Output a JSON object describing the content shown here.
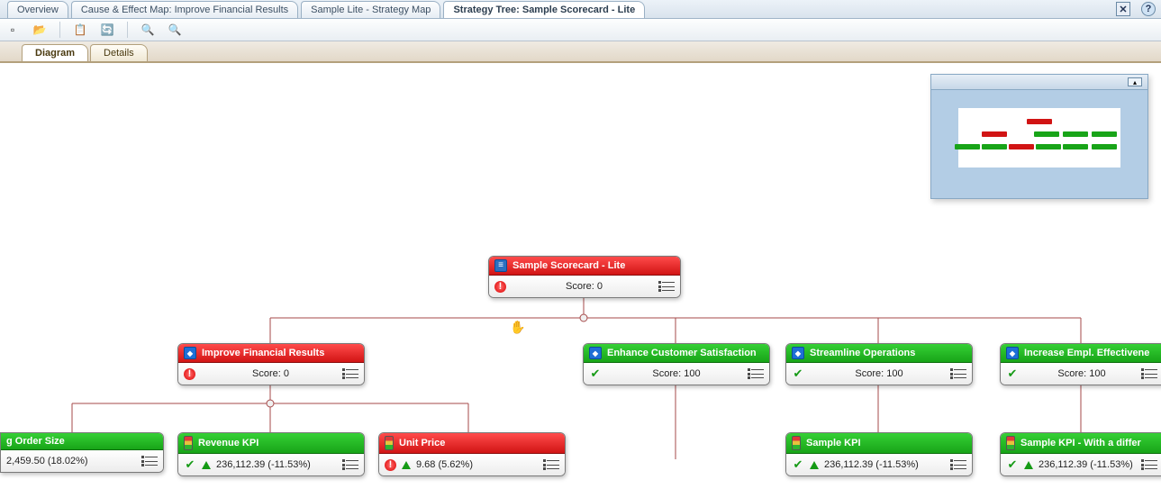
{
  "tabs": {
    "items": [
      "Overview",
      "Cause & Effect Map: Improve Financial Results",
      "Sample Lite - Strategy Map",
      "Strategy Tree: Sample Scorecard - Lite"
    ],
    "active_index": 3
  },
  "subtabs": {
    "items": [
      "Diagram",
      "Details"
    ],
    "active_index": 0
  },
  "colors": {
    "red": "#e02020",
    "green": "#1fba1f"
  },
  "nodes": {
    "root": {
      "title": "Sample Scorecard - Lite",
      "score": "Score: 0",
      "status": "warn",
      "hdr": "red"
    },
    "o1": {
      "title": "Improve Financial Results",
      "score": "Score: 0",
      "status": "warn",
      "hdr": "red"
    },
    "o2": {
      "title": "Enhance Customer Satisfaction",
      "score": "Score: 100",
      "status": "ok",
      "hdr": "green"
    },
    "o3": {
      "title": "Streamline Operations",
      "score": "Score: 100",
      "status": "ok",
      "hdr": "green"
    },
    "o4": {
      "title": "Increase Empl. Effectivene",
      "score": "Score: 100",
      "status": "ok",
      "hdr": "green"
    },
    "k1": {
      "title": "g Order Size",
      "value": "2,459.50 (18.02%)",
      "hdr": "green"
    },
    "k2": {
      "title": "Revenue KPI",
      "value": "236,112.39 (-11.53%)",
      "hdr": "green"
    },
    "k3": {
      "title": "Unit Price",
      "value": "9.68 (5.62%)",
      "hdr": "red"
    },
    "k4": {
      "title": "Sample KPI",
      "value": "236,112.39 (-11.53%)",
      "hdr": "green"
    },
    "k5": {
      "title": "Sample KPI - With a differ",
      "value": "236,112.39 (-11.53%)",
      "hdr": "green"
    }
  }
}
